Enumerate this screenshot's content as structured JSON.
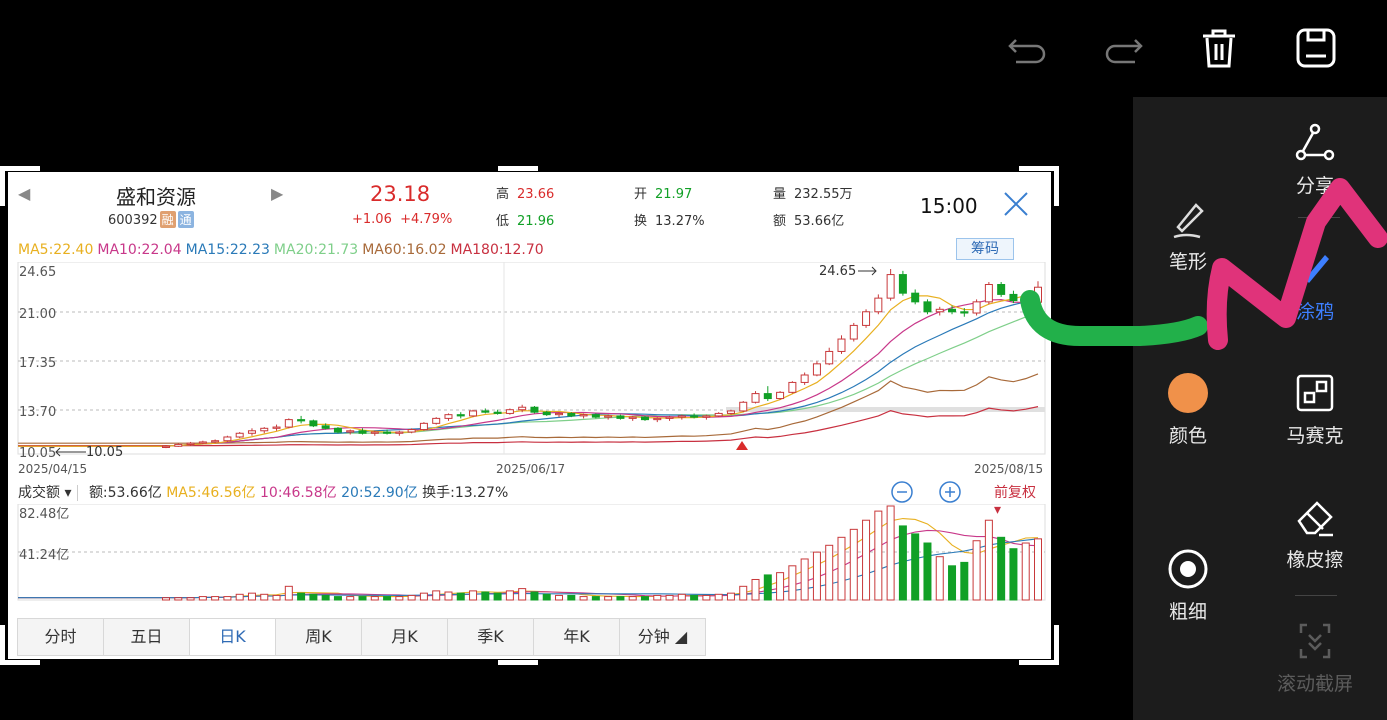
{
  "toolbar": {
    "icons": [
      "undo-icon",
      "redo-icon",
      "delete-icon",
      "save-icon"
    ]
  },
  "tools": {
    "split": "分享",
    "pen_shape": "笔形",
    "doodle": "涂鸦",
    "color": "颜色",
    "color_value": "#f0914a",
    "mosaic": "马赛克",
    "eraser": "橡皮擦",
    "thickness": "粗细",
    "scroll_capture": "滚动截屏"
  },
  "stock": {
    "name": "盛和资源",
    "code": "600392",
    "badge_rong": "融",
    "badge_tong": "通",
    "price": "23.18",
    "change": "+1.06",
    "change_pct": "+4.79%",
    "high_label": "高",
    "high": "23.66",
    "low_label": "低",
    "low": "21.96",
    "open_label": "开",
    "open": "21.97",
    "turnover_label": "换",
    "turnover": "13.27%",
    "volume_label": "量",
    "volume": "232.55万",
    "amount_label": "额",
    "amount": "53.66亿",
    "time": "15:00"
  },
  "ma": {
    "ma5": "MA5:22.40",
    "ma10": "MA10:22.04",
    "ma15": "MA15:22.23",
    "ma20": "MA20:21.73",
    "ma60": "MA60:16.02",
    "ma180": "MA180:12.70",
    "chip_button": "筹码"
  },
  "price_chart": {
    "y_ticks": [
      "24.65",
      "21.00",
      "17.35",
      "13.70",
      "10.05"
    ],
    "high_marker": "24.65",
    "low_marker": "10.05",
    "dates": [
      "2025/04/15",
      "2025/06/17",
      "2025/08/15"
    ]
  },
  "volume_chart": {
    "selector": "成交额",
    "amount": "额:53.66亿",
    "ma5": "MA5:46.56亿",
    "ma10": "10:46.58亿",
    "ma20": "20:52.90亿",
    "turnover": "换手:13.27%",
    "adjust": "前复权",
    "y_top": "82.48亿",
    "y_mid": "41.24亿"
  },
  "tabs": [
    "分时",
    "五日",
    "日K",
    "周K",
    "月K",
    "季K",
    "年K",
    "分钟"
  ],
  "chart_data": {
    "type": "bar",
    "title": "",
    "candles": [
      [
        10.3,
        10.4,
        10.2,
        10.35
      ],
      [
        10.35,
        10.6,
        10.3,
        10.5
      ],
      [
        10.5,
        10.7,
        10.4,
        10.6
      ],
      [
        10.6,
        10.8,
        10.5,
        10.7
      ],
      [
        10.7,
        10.9,
        10.6,
        10.8
      ],
      [
        10.8,
        11.2,
        10.7,
        11.1
      ],
      [
        11.1,
        11.5,
        11.0,
        11.4
      ],
      [
        11.4,
        11.8,
        11.2,
        11.6
      ],
      [
        11.6,
        11.9,
        11.4,
        11.8
      ],
      [
        11.8,
        12.1,
        11.6,
        11.9
      ],
      [
        11.9,
        12.6,
        11.8,
        12.5
      ],
      [
        12.5,
        12.8,
        12.2,
        12.4
      ],
      [
        12.4,
        12.5,
        11.9,
        12.0
      ],
      [
        12.0,
        12.2,
        11.7,
        11.8
      ],
      [
        11.8,
        11.9,
        11.4,
        11.5
      ],
      [
        11.5,
        11.7,
        11.3,
        11.6
      ],
      [
        11.6,
        11.8,
        11.3,
        11.4
      ],
      [
        11.4,
        11.6,
        11.2,
        11.5
      ],
      [
        11.5,
        11.7,
        11.3,
        11.4
      ],
      [
        11.4,
        11.6,
        11.2,
        11.5
      ],
      [
        11.5,
        11.8,
        11.4,
        11.7
      ],
      [
        11.7,
        12.3,
        11.6,
        12.2
      ],
      [
        12.2,
        12.7,
        12.1,
        12.6
      ],
      [
        12.6,
        13.0,
        12.4,
        12.9
      ],
      [
        12.9,
        13.1,
        12.6,
        12.8
      ],
      [
        12.8,
        13.3,
        12.7,
        13.2
      ],
      [
        13.2,
        13.4,
        13.0,
        13.1
      ],
      [
        13.1,
        13.3,
        12.9,
        13.0
      ],
      [
        13.0,
        13.4,
        12.9,
        13.3
      ],
      [
        13.3,
        13.7,
        13.1,
        13.5
      ],
      [
        13.5,
        13.6,
        13.0,
        13.1
      ],
      [
        13.1,
        13.2,
        12.8,
        12.9
      ],
      [
        12.9,
        13.1,
        12.7,
        13.0
      ],
      [
        13.0,
        13.1,
        12.7,
        12.8
      ],
      [
        12.8,
        13.0,
        12.6,
        12.9
      ],
      [
        12.9,
        13.0,
        12.6,
        12.7
      ],
      [
        12.7,
        12.9,
        12.5,
        12.8
      ],
      [
        12.8,
        12.9,
        12.5,
        12.6
      ],
      [
        12.6,
        12.8,
        12.4,
        12.7
      ],
      [
        12.7,
        12.8,
        12.4,
        12.5
      ],
      [
        12.5,
        12.7,
        12.3,
        12.6
      ],
      [
        12.6,
        12.8,
        12.4,
        12.7
      ],
      [
        12.7,
        12.9,
        12.5,
        12.8
      ],
      [
        12.8,
        13.0,
        12.6,
        12.7
      ],
      [
        12.7,
        12.9,
        12.5,
        12.8
      ],
      [
        12.8,
        13.1,
        12.7,
        13.0
      ],
      [
        13.0,
        13.3,
        12.9,
        13.2
      ],
      [
        13.2,
        14.0,
        13.1,
        13.9
      ],
      [
        13.9,
        14.8,
        13.8,
        14.6
      ],
      [
        14.6,
        15.2,
        14.0,
        14.2
      ],
      [
        14.2,
        14.8,
        14.1,
        14.7
      ],
      [
        14.7,
        15.6,
        14.6,
        15.5
      ],
      [
        15.5,
        16.3,
        15.3,
        16.1
      ],
      [
        16.1,
        17.2,
        16.0,
        17.0
      ],
      [
        17.0,
        18.3,
        16.9,
        18.0
      ],
      [
        18.0,
        19.3,
        17.8,
        19.0
      ],
      [
        19.0,
        20.3,
        18.8,
        20.1
      ],
      [
        20.1,
        21.4,
        19.9,
        21.2
      ],
      [
        21.2,
        22.6,
        21.0,
        22.3
      ],
      [
        22.3,
        24.65,
        22.1,
        24.2
      ],
      [
        24.2,
        24.5,
        22.5,
        22.7
      ],
      [
        22.7,
        23.0,
        21.8,
        22.0
      ],
      [
        22.0,
        22.2,
        21.0,
        21.2
      ],
      [
        21.2,
        21.6,
        20.9,
        21.4
      ],
      [
        21.4,
        21.7,
        21.0,
        21.2
      ],
      [
        21.2,
        21.5,
        20.8,
        21.1
      ],
      [
        21.1,
        22.2,
        20.9,
        22.0
      ],
      [
        22.0,
        23.6,
        21.8,
        23.4
      ],
      [
        23.4,
        23.6,
        22.4,
        22.6
      ],
      [
        22.6,
        22.9,
        21.9,
        22.1
      ],
      [
        22.1,
        22.7,
        21.9,
        22.5
      ],
      [
        21.97,
        23.66,
        21.96,
        23.18
      ]
    ],
    "amount": [
      2,
      2,
      2,
      3,
      3,
      3,
      5,
      6,
      5,
      4,
      12,
      6,
      5,
      4,
      3,
      3,
      3,
      3,
      3,
      3,
      4,
      6,
      8,
      7,
      6,
      8,
      7,
      6,
      8,
      10,
      7,
      5,
      4,
      4,
      3,
      3,
      3,
      3,
      3,
      3,
      4,
      4,
      5,
      4,
      4,
      5,
      6,
      12,
      18,
      22,
      24,
      30,
      36,
      42,
      48,
      55,
      62,
      70,
      78,
      82.48,
      65,
      58,
      50,
      38,
      30,
      33,
      52,
      70,
      55,
      45,
      50,
      53.66
    ],
    "ylim": [
      10.05,
      24.65
    ]
  }
}
